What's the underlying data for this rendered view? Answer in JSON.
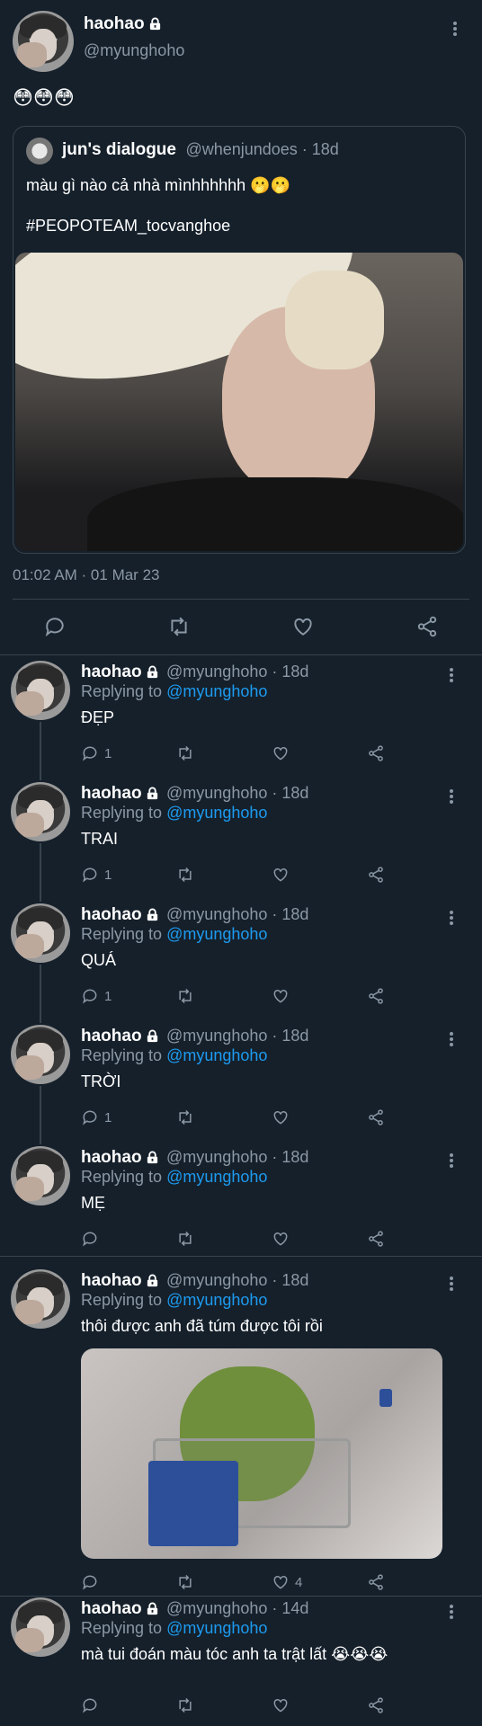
{
  "main_tweet": {
    "name": "haohao",
    "handle": "@myunghoho",
    "text": "😳😳😳",
    "quote": {
      "name": "jun's dialogue",
      "handle_time": "@whenjundoes · 18d",
      "text": "màu gì nào cả nhà mìnhhhhhh 🫢🫢",
      "hashtag": "#PEOPOTEAM_tocvanghoe"
    },
    "timestamp": "01:02 AM · 01 Mar 23"
  },
  "replies": [
    {
      "name": "haohao",
      "meta": "@myunghoho · 18d",
      "replying_prefix": "Replying to",
      "replying_to": "@myunghoho",
      "text": "ĐẸP",
      "reply_count": "1",
      "retweet_count": "",
      "like_count": ""
    },
    {
      "name": "haohao",
      "meta": "@myunghoho · 18d",
      "replying_prefix": "Replying to",
      "replying_to": "@myunghoho",
      "text": "TRAI",
      "reply_count": "1",
      "retweet_count": "",
      "like_count": ""
    },
    {
      "name": "haohao",
      "meta": "@myunghoho · 18d",
      "replying_prefix": "Replying to",
      "replying_to": "@myunghoho",
      "text": "QUÁ",
      "reply_count": "1",
      "retweet_count": "",
      "like_count": ""
    },
    {
      "name": "haohao",
      "meta": "@myunghoho · 18d",
      "replying_prefix": "Replying to",
      "replying_to": "@myunghoho",
      "text": "TRỜI",
      "reply_count": "1",
      "retweet_count": "",
      "like_count": ""
    },
    {
      "name": "haohao",
      "meta": "@myunghoho · 18d",
      "replying_prefix": "Replying to",
      "replying_to": "@myunghoho",
      "text": "MẸ",
      "reply_count": "",
      "retweet_count": "",
      "like_count": ""
    },
    {
      "name": "haohao",
      "meta": "@myunghoho · 18d",
      "replying_prefix": "Replying to",
      "replying_to": "@myunghoho",
      "text": "thôi được anh đã túm được tôi rồi",
      "reply_count": "",
      "retweet_count": "",
      "like_count": "4"
    },
    {
      "name": "haohao",
      "meta": "@myunghoho · 14d",
      "replying_prefix": "Replying to",
      "replying_to": "@myunghoho",
      "text": "mà tui đoán màu tóc anh ta trật lất 😭😭😭",
      "reply_count": "",
      "retweet_count": "",
      "like_count": ""
    }
  ],
  "colors": {
    "background": "#15202b",
    "divider": "#38444d",
    "secondary_text": "#8b98a5",
    "link": "#1d9bf0"
  }
}
